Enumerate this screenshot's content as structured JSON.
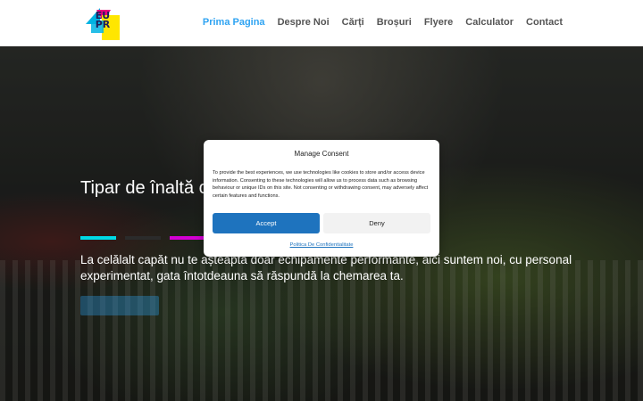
{
  "logo": {
    "text_line1": "EU",
    "text_line2": "PR",
    "colors": [
      "#00b3e3",
      "#e6007e",
      "#ffe600",
      "#1e1e5a"
    ]
  },
  "nav": {
    "items": [
      {
        "label": "Prima Pagina",
        "active": true
      },
      {
        "label": "Despre Noi",
        "active": false
      },
      {
        "label": "Cărți",
        "active": false
      },
      {
        "label": "Broșuri",
        "active": false
      },
      {
        "label": "Flyere",
        "active": false
      },
      {
        "label": "Calculator",
        "active": false
      },
      {
        "label": "Contact",
        "active": false
      }
    ]
  },
  "hero": {
    "title": "Tipar de înaltă calitate, cu predare chiar",
    "subtitle": "La celălalt capăt nu te așteaptă doar echipamente performante, aici suntem noi, cu personal experimentat, gata întotdeauna să răspundă la chemarea ta.",
    "accent_colors": [
      "#00d9e6",
      "#2b2b2b",
      "#d400d4",
      "#2b2b2b"
    ]
  },
  "consent": {
    "title": "Manage Consent",
    "body": "To provide the best experiences, we use technologies like cookies to store and/or access device information. Consenting to these technologies will allow us to process data such as browsing behaviour or unique IDs on this site. Not consenting or withdrawing consent, may adversely affect certain features and functions.",
    "accept_label": "Accept",
    "deny_label": "Deny",
    "policy_link": "Politica De Confidentialitate"
  },
  "colors": {
    "accent": "#2ea3f2",
    "accept_button": "#1e73be"
  }
}
